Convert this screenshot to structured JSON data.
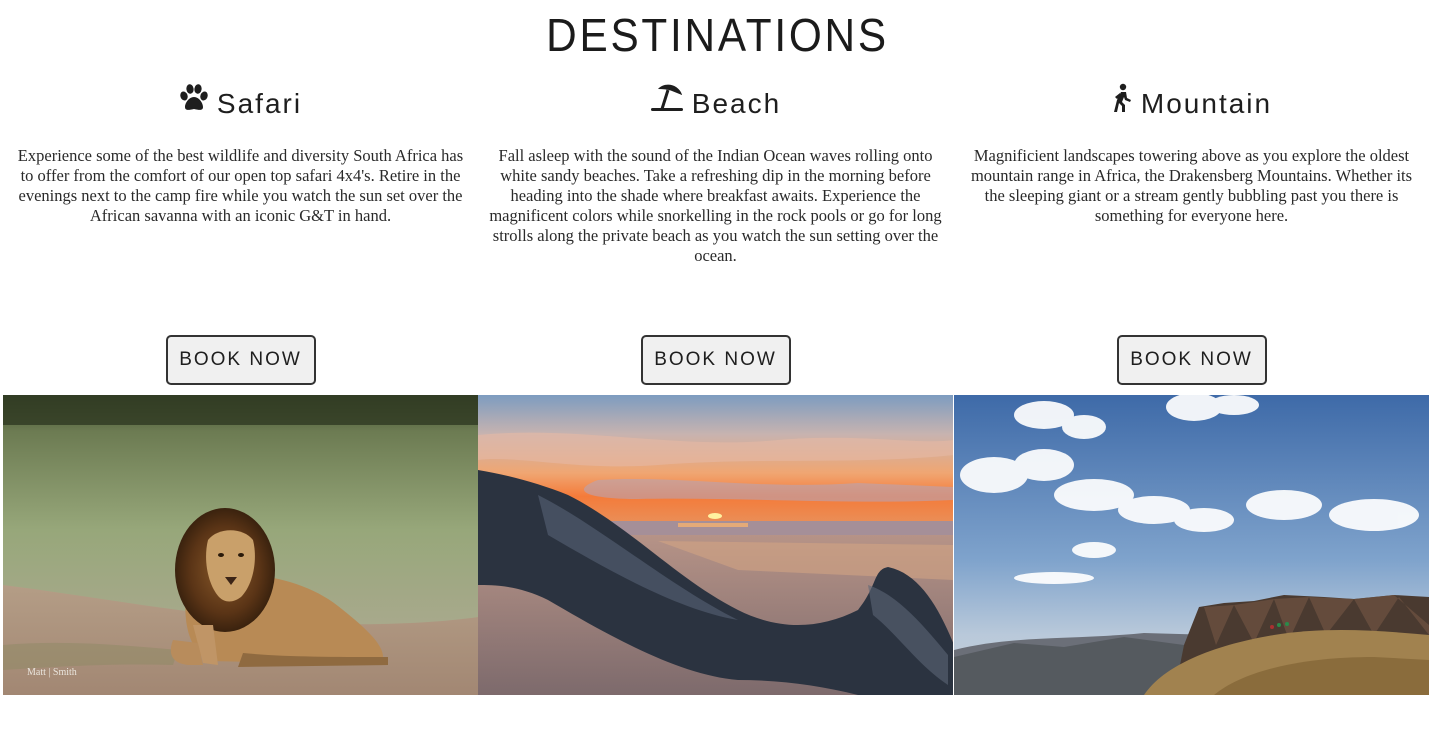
{
  "page": {
    "title": "DESTINATIONS"
  },
  "destinations": [
    {
      "icon": "paw-icon",
      "name": "Safari",
      "description": "Experience some of the best wildlife and diversity South Africa has to offer from the comfort of our open top safari 4x4's. Retire in the evenings next to the camp fire while you watch the sun set over the African savanna with an iconic G&T in hand.",
      "button_label": "BOOK NOW",
      "image": {
        "subject": "lion lying in savanna grass",
        "credit": "Matt | Smith"
      }
    },
    {
      "icon": "umbrella-beach-icon",
      "name": "Beach",
      "description": "Fall asleep with the sound of the Indian Ocean waves rolling onto white sandy beaches. Take a refreshing dip in the morning before heading into the shade where breakfast awaits. Experience the magnificent colors while snorkelling in the rock pools or go for long strolls along the private beach as you watch the sun setting over the ocean.",
      "button_label": "BOOK NOW",
      "image": {
        "subject": "driftwood on beach at sunset"
      }
    },
    {
      "icon": "hiking-icon",
      "name": "Mountain",
      "description": "Magnificient landscapes towering above as you explore the oldest mountain range in Africa, the Drakensberg Mountains. Whether its the sleeping giant or a stream gently bubbling past you there is something for everyone here.",
      "button_label": "BOOK NOW",
      "image": {
        "subject": "Drakensberg mountain escarpment under cloudy sky"
      }
    }
  ]
}
